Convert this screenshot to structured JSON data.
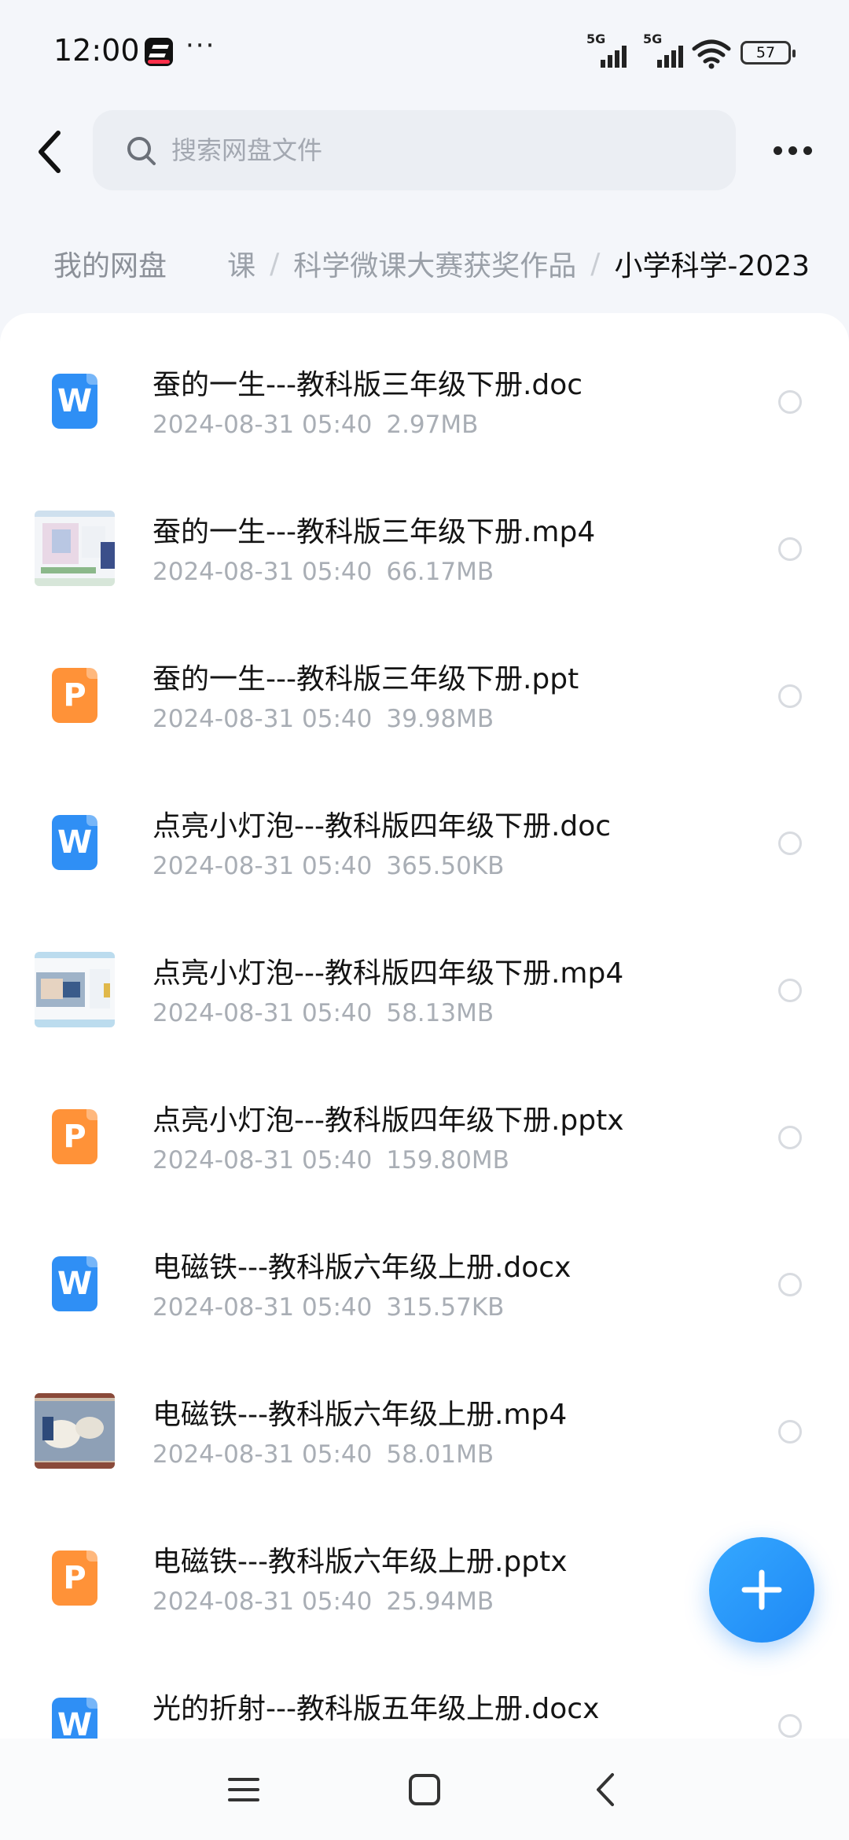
{
  "status_bar": {
    "time": "12:00",
    "more": "···",
    "signal1_label": "5G",
    "signal2_label": "5G",
    "battery": "57"
  },
  "header": {
    "search_placeholder": "搜索网盘文件"
  },
  "breadcrumb": {
    "root": "我的网盘",
    "items": [
      "课",
      "科学微课大赛获奖作品",
      "小学科学-2023"
    ],
    "separator": "/"
  },
  "files": [
    {
      "name": "蚕的一生---教科版三年级下册.doc",
      "date": "2024-08-31  05:40",
      "size": "2.97MB",
      "type": "word"
    },
    {
      "name": "蚕的一生---教科版三年级下册.mp4",
      "date": "2024-08-31  05:40",
      "size": "66.17MB",
      "type": "video"
    },
    {
      "name": "蚕的一生---教科版三年级下册.ppt",
      "date": "2024-08-31  05:40",
      "size": "39.98MB",
      "type": "ppt"
    },
    {
      "name": "点亮小灯泡---教科版四年级下册.doc",
      "date": "2024-08-31  05:40",
      "size": "365.50KB",
      "type": "word"
    },
    {
      "name": "点亮小灯泡---教科版四年级下册.mp4",
      "date": "2024-08-31  05:40",
      "size": "58.13MB",
      "type": "video"
    },
    {
      "name": "点亮小灯泡---教科版四年级下册.pptx",
      "date": "2024-08-31  05:40",
      "size": "159.80MB",
      "type": "ppt"
    },
    {
      "name": "电磁铁---教科版六年级上册.docx",
      "date": "2024-08-31  05:40",
      "size": "315.57KB",
      "type": "word"
    },
    {
      "name": "电磁铁---教科版六年级上册.mp4",
      "date": "2024-08-31  05:40",
      "size": "58.01MB",
      "type": "video"
    },
    {
      "name": "电磁铁---教科版六年级上册.pptx",
      "date": "2024-08-31  05:40",
      "size": "25.94MB",
      "type": "ppt"
    },
    {
      "name": "光的折射---教科版五年级上册.docx",
      "date": "",
      "size": "",
      "type": "word"
    }
  ],
  "icons": {
    "word_letter": "W",
    "ppt_letter": "P"
  },
  "colors": {
    "accent": "#1e88f5",
    "word": "#2f8ff5",
    "ppt": "#ff9238"
  }
}
